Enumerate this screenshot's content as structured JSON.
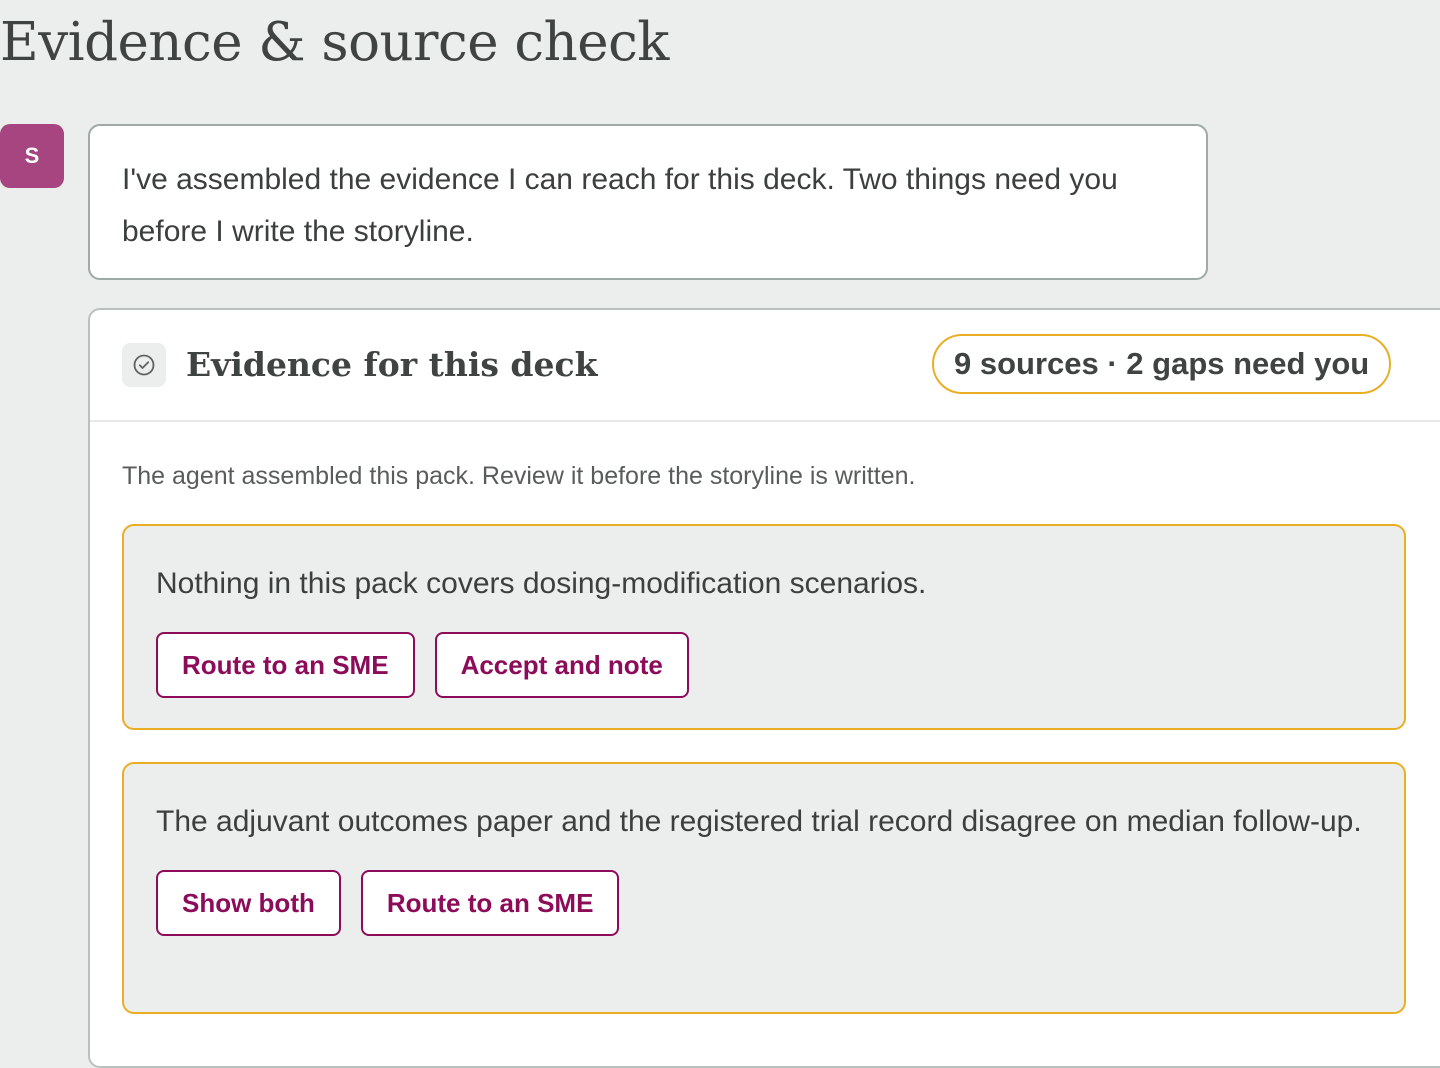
{
  "page": {
    "title": "Evidence & source check"
  },
  "message": {
    "avatar_initial": "S",
    "text": "I've assembled the evidence I can reach for this deck. Two things need you before I write the storyline."
  },
  "evidence_card": {
    "icon": "check-circle-icon",
    "title": "Evidence for this deck",
    "status": "9 sources · 2 gaps need you",
    "description": "The agent assembled this pack. Review it before the storyline is written.",
    "gaps": [
      {
        "text": "Nothing in this pack covers dosing-modification scenarios.",
        "actions": [
          "Route to an SME",
          "Accept and note"
        ]
      },
      {
        "text": "The adjuvant outcomes paper and the registered trial record disagree on median follow-up.",
        "actions": [
          "Show both",
          "Route to an SME"
        ]
      }
    ]
  },
  "colors": {
    "background": "#ebeeed",
    "avatar": "#a6457f",
    "warning_border": "#e9ae24",
    "action_accent": "#8c0c5a"
  }
}
